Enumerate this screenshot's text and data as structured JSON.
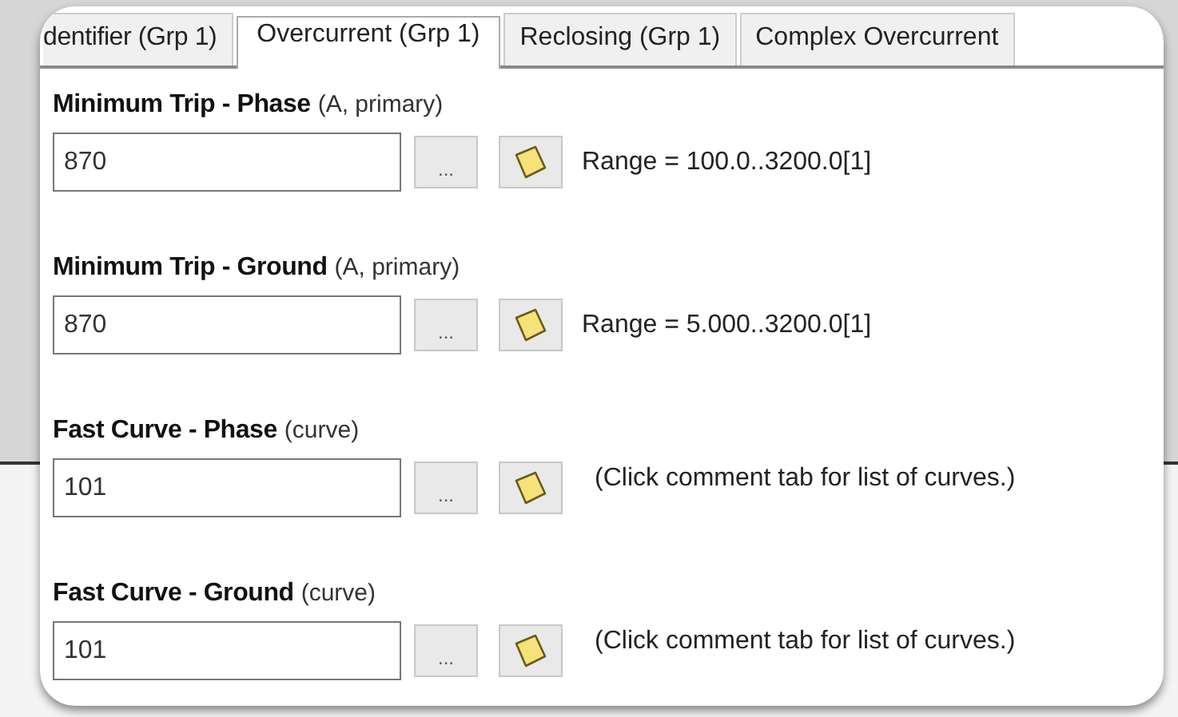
{
  "tabs": [
    {
      "label": "dentifier (Grp 1)",
      "selected": false
    },
    {
      "label": "Overcurrent (Grp 1)",
      "selected": true
    },
    {
      "label": "Reclosing (Grp 1)",
      "selected": false
    },
    {
      "label": "Complex Overcurrent",
      "selected": false
    }
  ],
  "settings": [
    {
      "title": "Minimum Trip - Phase",
      "units": "(A, primary)",
      "value": "870",
      "browse": "...",
      "hint": "Range = 100.0..3200.0[1]"
    },
    {
      "title": "Minimum Trip - Ground",
      "units": "(A, primary)",
      "value": "870",
      "browse": "...",
      "hint": "Range = 5.000..3200.0[1]"
    },
    {
      "title": "Fast Curve - Phase",
      "units": "(curve)",
      "value": "101",
      "browse": "...",
      "hint": "(Click comment tab for list of curves.)"
    },
    {
      "title": "Fast Curve - Ground",
      "units": "(curve)",
      "value": "101",
      "browse": "...",
      "hint": "(Click comment tab for list of curves.)"
    }
  ]
}
